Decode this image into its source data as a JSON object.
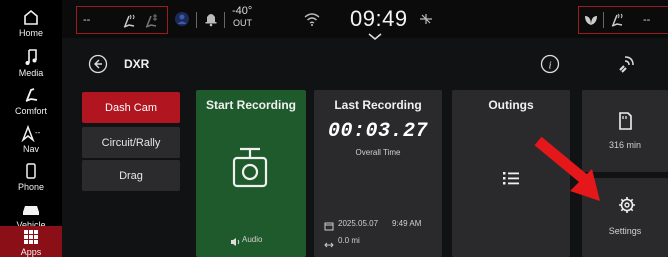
{
  "nav": [
    {
      "key": "home",
      "label": "Home",
      "icon": "home-icon"
    },
    {
      "key": "media",
      "label": "Media",
      "icon": "music-note-icon"
    },
    {
      "key": "comfort",
      "label": "Comfort",
      "icon": "seat-icon"
    },
    {
      "key": "nav",
      "label": "Nav",
      "icon": "navigation-arrow-icon"
    },
    {
      "key": "phone",
      "label": "Phone",
      "icon": "phone-icon"
    },
    {
      "key": "vehicle",
      "label": "Vehicle",
      "icon": "car-icon"
    },
    {
      "key": "apps",
      "label": "Apps",
      "icon": "apps-grid-icon"
    }
  ],
  "status_bar": {
    "left_dash": "--",
    "temperature": "-40°",
    "temperature_label": "OUT",
    "time": "09:49",
    "right_dash": "--"
  },
  "header": {
    "title": "DXR"
  },
  "menu": [
    {
      "label": "Dash Cam",
      "active": true
    },
    {
      "label": "Circuit/Rally",
      "active": false
    },
    {
      "label": "Drag",
      "active": false
    }
  ],
  "cards": {
    "start_recording": {
      "title": "Start Recording",
      "audio_label": "Audio"
    },
    "last_recording": {
      "title": "Last Recording",
      "time": "00:03.27",
      "time_caption": "Overall Time",
      "date": "2025.05.07",
      "clock": "9:49 AM",
      "distance": "0.0 mi"
    },
    "outings": {
      "title": "Outings"
    },
    "storage": {
      "value": "316 min"
    },
    "settings": {
      "label": "Settings"
    }
  },
  "colors": {
    "accent_red": "#b01520",
    "nav_active": "#8a0f16",
    "start_card": "#1f5a2c",
    "callout_arrow": "#e4171b"
  }
}
